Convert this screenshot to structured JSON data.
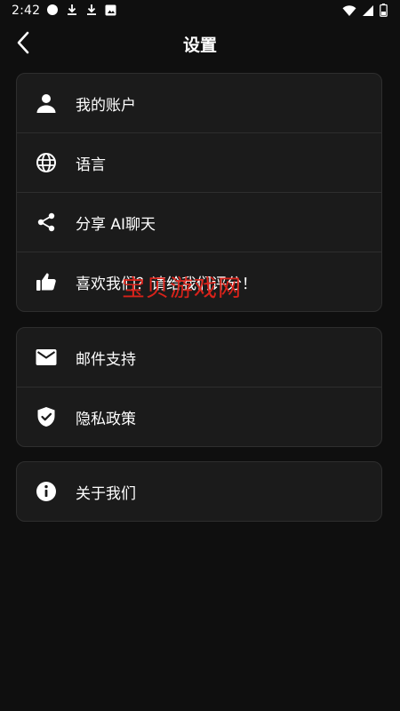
{
  "status_bar": {
    "time": "2:42",
    "left_icons": [
      "circle-icon",
      "download-icon",
      "download-icon",
      "photo-icon"
    ],
    "right_icons": [
      "wifi-icon",
      "signal-icon",
      "battery-icon"
    ]
  },
  "header": {
    "title": "设置",
    "back_icon": "chevron-left-icon"
  },
  "groups": [
    {
      "items": [
        {
          "icon": "person-icon",
          "label": "我的账户"
        },
        {
          "icon": "globe-icon",
          "label": "语言"
        },
        {
          "icon": "share-icon",
          "label": "分享 AI聊天"
        },
        {
          "icon": "thumbs-up-icon",
          "label": "喜欢我们？请给我们评分！"
        }
      ]
    },
    {
      "items": [
        {
          "icon": "mail-icon",
          "label": "邮件支持"
        },
        {
          "icon": "shield-check-icon",
          "label": "隐私政策"
        }
      ]
    },
    {
      "items": [
        {
          "icon": "info-icon",
          "label": "关于我们"
        }
      ]
    }
  ],
  "watermark": "宝贝游戏网",
  "colors": {
    "background": "#0f0f0f",
    "card": "#1b1b1b",
    "divider": "#2e2e2e",
    "text": "#ffffff",
    "watermark": "#e2231a"
  }
}
